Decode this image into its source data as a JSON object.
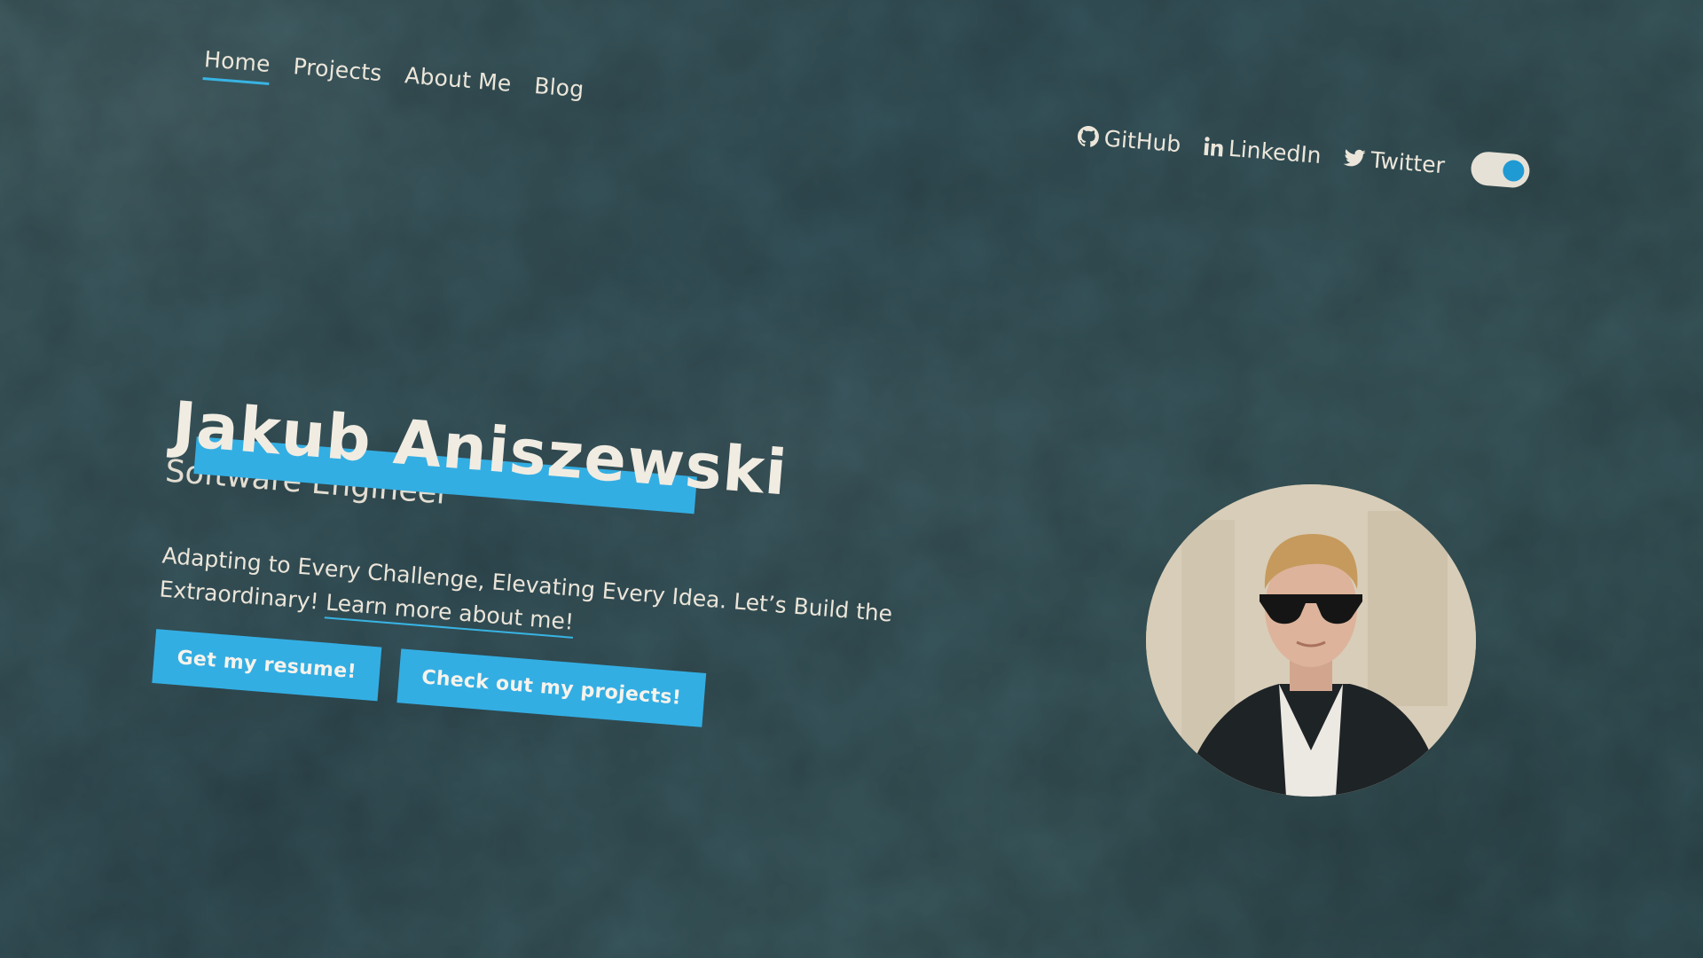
{
  "nav": {
    "items": [
      {
        "label": "Home",
        "active": true
      },
      {
        "label": "Projects",
        "active": false
      },
      {
        "label": "About Me",
        "active": false
      },
      {
        "label": "Blog",
        "active": false
      }
    ]
  },
  "social": {
    "github": {
      "label": "GitHub",
      "icon": "github-icon"
    },
    "linkedin": {
      "label": "LinkedIn",
      "icon": "linkedin-icon"
    },
    "twitter": {
      "label": "Twitter",
      "icon": "twitter-icon"
    },
    "theme_toggle": {
      "on": true
    }
  },
  "hero": {
    "name": "Jakub Aniszewski",
    "role": "Software Engineer",
    "tagline": "Adapting to Every Challenge, Elevating Every Idea. Let’s Build the Extraordinary!",
    "learn_more_label": "Learn more about me!",
    "resume_button": "Get my resume!",
    "projects_button": "Check out my projects!"
  },
  "colors": {
    "background": "#3a575c",
    "accent": "#33aee3",
    "text": "#ece6da"
  }
}
